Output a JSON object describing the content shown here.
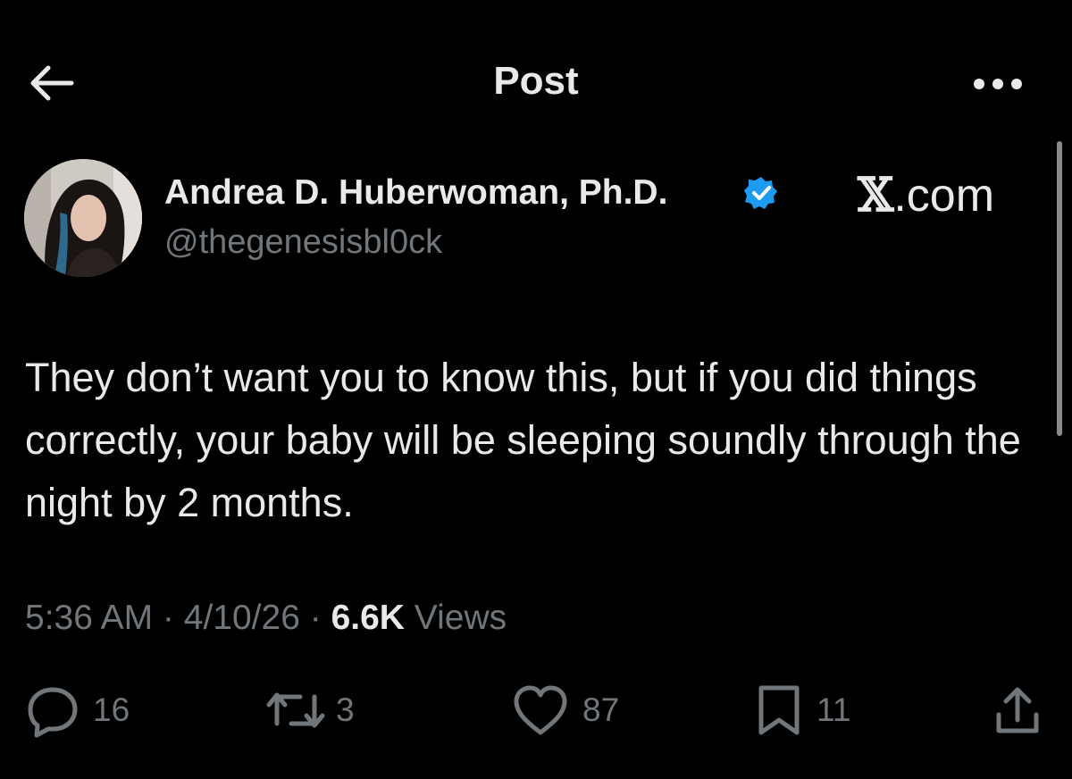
{
  "header": {
    "title": "Post"
  },
  "author": {
    "display_name": "Andrea D. Huberwoman, Ph.D.",
    "handle": "@thegenesisbl0ck",
    "verified": true
  },
  "watermark": {
    "x_glyph": "𝕏",
    "suffix": ".com"
  },
  "post": {
    "text": "They don’t want you to know this, but if you did things correctly, your baby will be sleeping soundly through the night by 2 months.",
    "time": "5:36 AM",
    "date": "4/10/26",
    "separator": " · ",
    "views_count": "6.6K",
    "views_label": " Views"
  },
  "actions": {
    "replies": "16",
    "reposts": "3",
    "likes": "87",
    "bookmarks": "11"
  },
  "colors": {
    "background": "#000000",
    "text": "#e7e9ea",
    "secondary": "#71767b",
    "verified": "#1d9bf0"
  },
  "icons": {
    "back": "arrow-left-icon",
    "more": "more-horizontal-icon",
    "verified": "verified-badge-icon",
    "reply": "reply-icon",
    "repost": "repost-icon",
    "like": "heart-icon",
    "bookmark": "bookmark-icon",
    "share": "share-icon"
  }
}
